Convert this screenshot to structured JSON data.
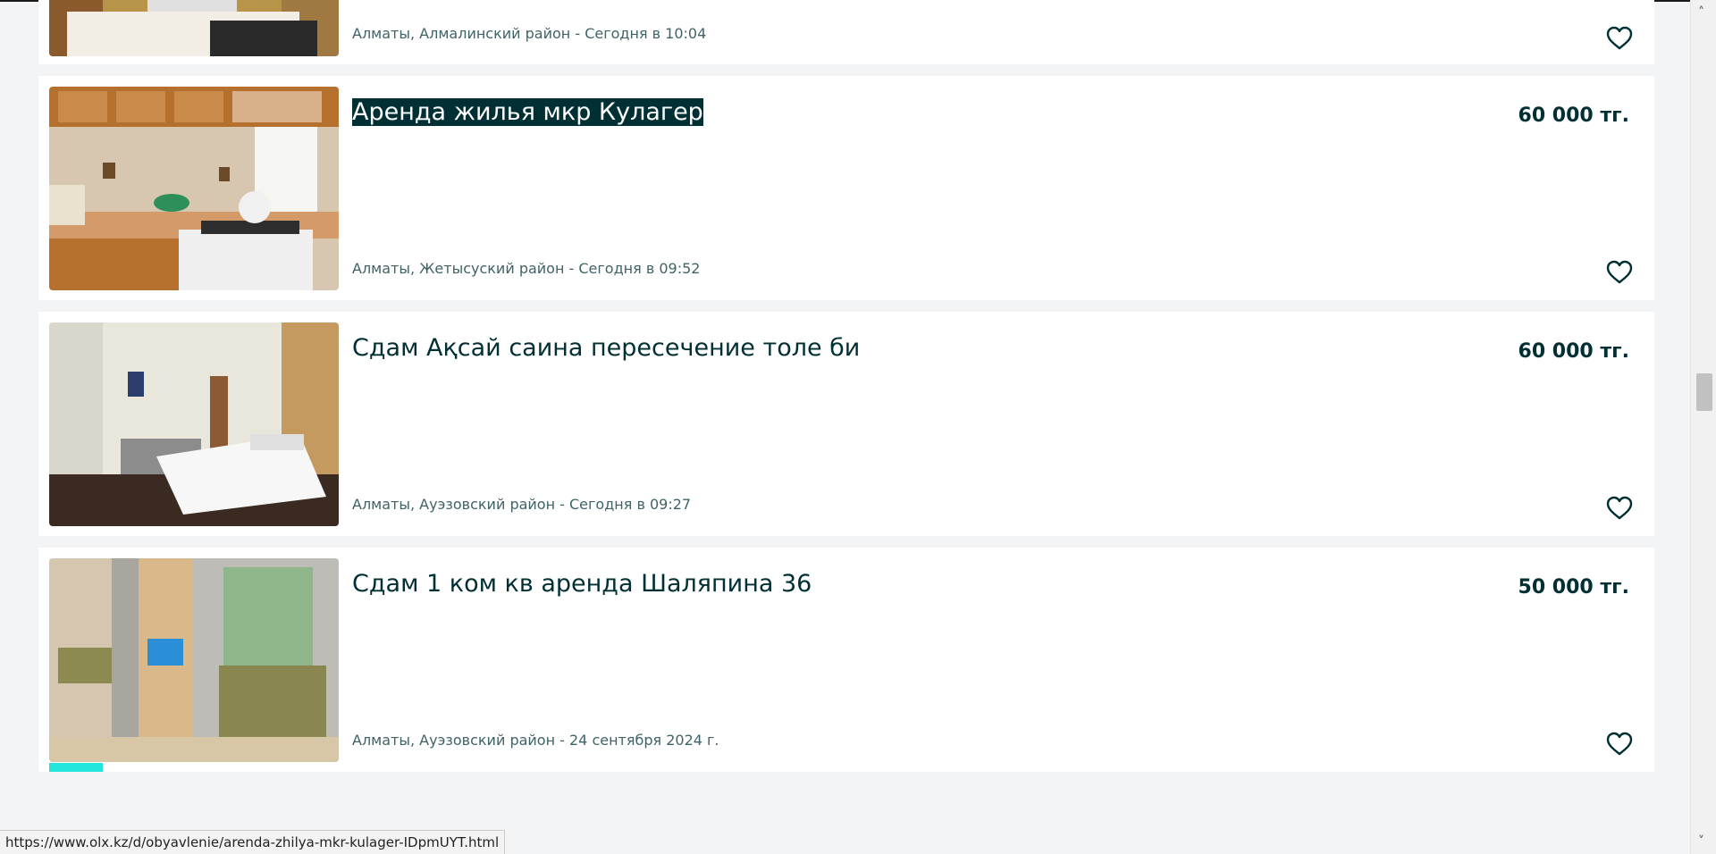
{
  "listings": [
    {
      "title": "",
      "price": "",
      "location": "Алматы, Алмалинский район - Сегодня в 10:04",
      "favorite_icon": "heart-outline-icon"
    },
    {
      "title": "Аренда жилья мкр Кулагер",
      "price": "60 000 тг.",
      "location": "Алматы, Жетысуский район - Сегодня в 09:52",
      "favorite_icon": "heart-outline-icon",
      "selected": true
    },
    {
      "title": "Сдам Ақсай саина пересечение толе би",
      "price": "60 000 тг.",
      "location": "Алматы, Ауэзовский район - Сегодня в 09:27",
      "favorite_icon": "heart-outline-icon"
    },
    {
      "title": "Сдам 1 ком кв аренда Шаляпина 36",
      "price": "50 000 тг.",
      "location": "Алматы, Ауэзовский район - 24 сентября 2024 г.",
      "favorite_icon": "heart-outline-icon"
    }
  ],
  "status_url": "https://www.olx.kz/d/obyavlenie/arenda-zhilya-mkr-kulager-IDpmUYT.html",
  "colors": {
    "text_primary": "#002f34",
    "text_secondary": "#406367",
    "badge": "#23e5db",
    "background": "#f2f4f5"
  }
}
